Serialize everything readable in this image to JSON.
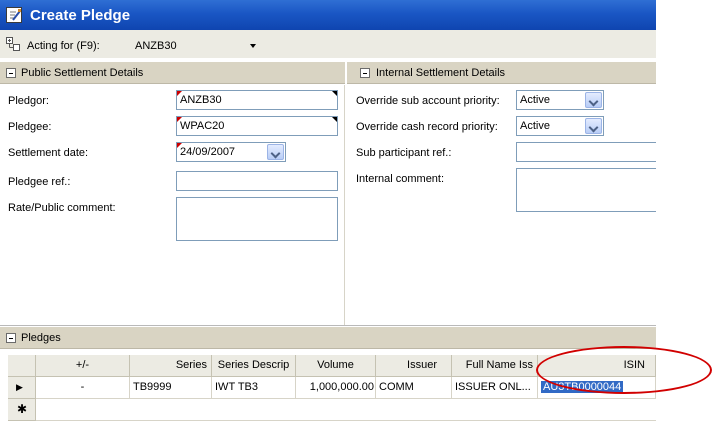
{
  "window": {
    "title": "Create Pledge"
  },
  "acting": {
    "label": "Acting for (F9):",
    "value": "ANZB30"
  },
  "public_settlement": {
    "header": "Public Settlement Details",
    "pledgor_label": "Pledgor:",
    "pledgor_value": "ANZB30",
    "pledgee_label": "Pledgee:",
    "pledgee_value": "WPAC20",
    "settlement_date_label": "Settlement date:",
    "settlement_date_value": "24/09/2007",
    "pledgee_ref_label": "Pledgee ref.:",
    "pledgee_ref_value": "",
    "rate_comment_label": "Rate/Public comment:",
    "rate_comment_value": ""
  },
  "internal_settlement": {
    "header": "Internal Settlement Details",
    "override_sub_label": "Override sub account priority:",
    "override_sub_value": "Active",
    "override_cash_label": "Override cash record priority:",
    "override_cash_value": "Active",
    "sub_participant_label": "Sub participant ref.:",
    "sub_participant_value": "",
    "internal_comment_label": "Internal comment:",
    "internal_comment_value": ""
  },
  "pledges": {
    "header": "Pledges",
    "columns": [
      "+/-",
      "Series",
      "Series Descrip",
      "Volume",
      "Issuer",
      "Full Name Iss",
      "ISIN"
    ],
    "rows": [
      {
        "pm": "-",
        "series": "TB9999",
        "series_descrip": "IWT TB3",
        "volume": "1,000,000.00",
        "issuer": "COMM",
        "full_name": "ISSUER ONL...",
        "isin": "AU3TB0000044"
      }
    ],
    "row_indicator": "▶",
    "new_row_indicator": "✱"
  },
  "annotation": {
    "color": "#d10000"
  }
}
